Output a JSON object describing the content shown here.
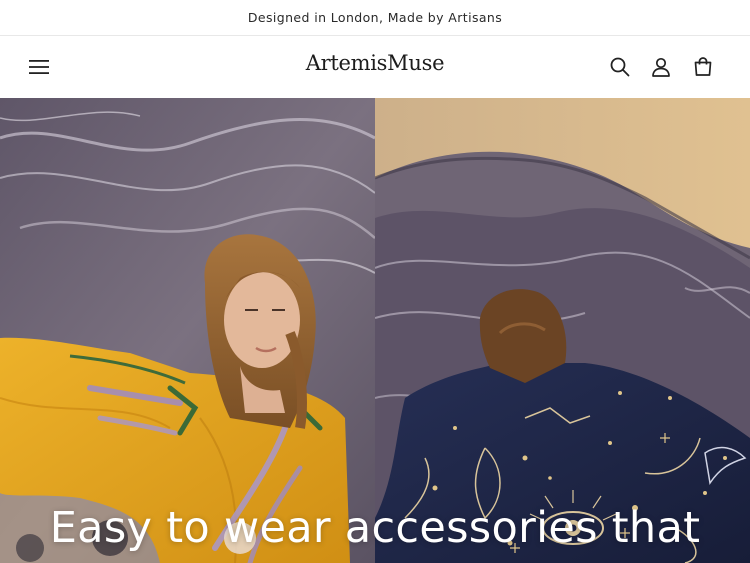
{
  "announcement": {
    "text": "Designed in London, Made by Artisans"
  },
  "header": {
    "logo": "ArtemisMuse",
    "icons": {
      "menu": "hamburger-menu-icon",
      "search": "search-icon",
      "account": "account-icon",
      "cart": "cart-icon"
    }
  },
  "hero": {
    "heading": "Easy to wear accessories that",
    "left_image": "model in yellow floral-embroidered kimono",
    "right_image": "model in navy celestial-embroidered kimono",
    "colors": {
      "yellow_kimono": "#e2a11f",
      "navy_kimono": "#1f2748",
      "marble_purple": "#6f6575",
      "marble_gold": "#d6b27a"
    }
  }
}
